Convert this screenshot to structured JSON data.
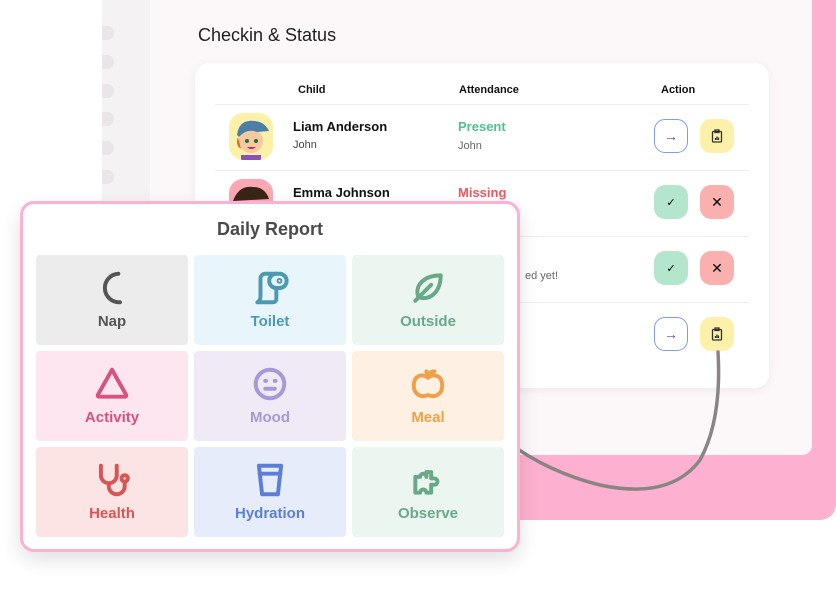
{
  "page": {
    "title": "Checkin & Status"
  },
  "table": {
    "headers": {
      "child": "Child",
      "attendance": "Attendance",
      "action": "Action"
    },
    "rows": [
      {
        "name": "Liam Anderson",
        "sub": "John",
        "status": "Present",
        "status_color": "#4cc38a",
        "status_sub": "John",
        "actions": [
          "arrow-right",
          "clipboard"
        ]
      },
      {
        "name": "Emma Johnson",
        "sub": "",
        "status": "Missing",
        "status_color": "#f0565f",
        "status_sub": "",
        "actions": [
          "check",
          "close"
        ]
      },
      {
        "name": "",
        "sub": "",
        "status": "",
        "status_sub": "ed yet!",
        "actions": [
          "check",
          "close"
        ]
      },
      {
        "name": "",
        "sub": "",
        "status": "",
        "status_sub": "",
        "actions": [
          "arrow-right",
          "clipboard"
        ]
      }
    ]
  },
  "daily_report": {
    "title": "Daily Report",
    "tiles": [
      {
        "label": "Nap",
        "icon": "moon-icon",
        "bg": "#ececec",
        "color": "#555555"
      },
      {
        "label": "Toilet",
        "icon": "toilet-paper-icon",
        "bg": "#e8f6fb",
        "color": "#4a9bb0"
      },
      {
        "label": "Outside",
        "icon": "leaf-icon",
        "bg": "#eaf6ef",
        "color": "#6aa88a"
      },
      {
        "label": "Activity",
        "icon": "triangle-icon",
        "bg": "#fde6ef",
        "color": "#d8517f"
      },
      {
        "label": "Mood",
        "icon": "neutral-face-icon",
        "bg": "#efeaf6",
        "color": "#a898d8"
      },
      {
        "label": "Meal",
        "icon": "apple-icon",
        "bg": "#fef1e3",
        "color": "#f0a048"
      },
      {
        "label": "Health",
        "icon": "stethoscope-icon",
        "bg": "#fde4e4",
        "color": "#d65555"
      },
      {
        "label": "Hydration",
        "icon": "glass-icon",
        "bg": "#e6ecf9",
        "color": "#5b7fd6"
      },
      {
        "label": "Observe",
        "icon": "puzzle-icon",
        "bg": "#eaf6ef",
        "color": "#6aa88a"
      }
    ]
  }
}
